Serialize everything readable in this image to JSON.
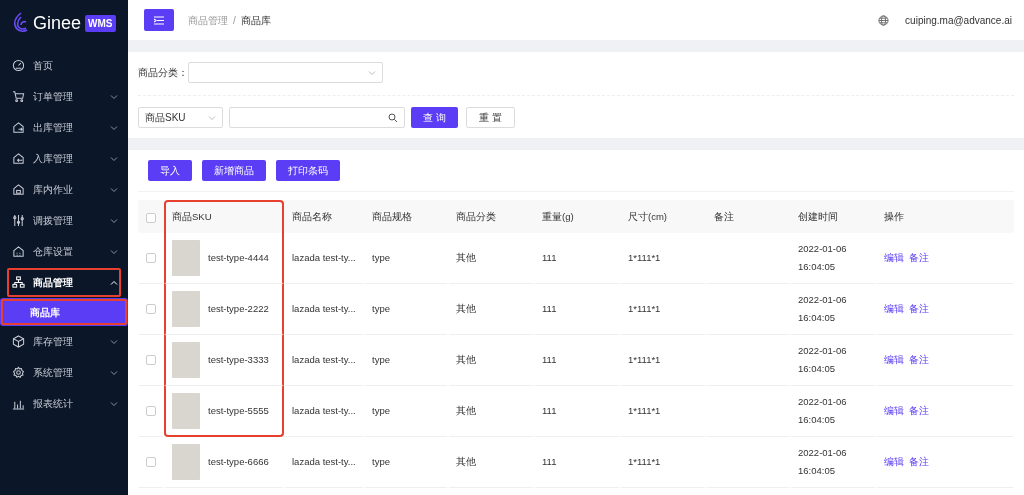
{
  "sidebar": {
    "logo": {
      "text": "Ginee",
      "badge": "WMS"
    },
    "items": [
      {
        "label": "首页",
        "selected": false,
        "highlighted": false
      },
      {
        "label": "订单管理",
        "expanded": false,
        "selected": false,
        "highlighted": false
      },
      {
        "label": "出库管理",
        "expanded": false,
        "selected": false,
        "highlighted": false
      },
      {
        "label": "入库管理",
        "expanded": false,
        "selected": false,
        "highlighted": false
      },
      {
        "label": "库内作业",
        "expanded": false,
        "selected": false,
        "highlighted": false
      },
      {
        "label": "调拨管理",
        "expanded": false,
        "selected": false,
        "highlighted": false
      },
      {
        "label": "仓库设置",
        "expanded": false,
        "selected": false,
        "highlighted": false
      },
      {
        "label": "商品管理",
        "expanded": true,
        "selected": true,
        "highlighted": true,
        "children": [
          {
            "label": "商品库",
            "selected": true,
            "highlighted": true
          }
        ]
      },
      {
        "label": "库存管理",
        "expanded": false,
        "selected": false,
        "highlighted": false
      },
      {
        "label": "系统管理",
        "expanded": false,
        "selected": false,
        "highlighted": false
      },
      {
        "label": "报表统计",
        "expanded": false,
        "selected": false,
        "highlighted": false
      }
    ]
  },
  "header": {
    "breadcrumb": [
      "商品管理",
      "/",
      "商品库"
    ],
    "user": "cuiping.ma@advance.ai"
  },
  "filters": {
    "category_label": "商品分类：",
    "search_type": "商品SKU",
    "buttons": [
      "查 询",
      "重 置"
    ]
  },
  "actions": [
    "导入",
    "新增商品",
    "打印条码"
  ],
  "table": {
    "all_checked": false,
    "columns": [
      {
        "label": "商品SKU",
        "highlighted": true
      },
      {
        "label": "商品名称",
        "highlighted": false
      },
      {
        "label": "商品规格",
        "highlighted": false
      },
      {
        "label": "商品分类",
        "highlighted": false
      },
      {
        "label": "重量(g)",
        "highlighted": false
      },
      {
        "label": "尺寸(cm)",
        "highlighted": false
      },
      {
        "label": "备注",
        "highlighted": false
      },
      {
        "label": "创建时间",
        "highlighted": false
      },
      {
        "label": "操作",
        "highlighted": false
      }
    ],
    "rows": [
      {
        "checked": false,
        "highlighted": true,
        "sku": "test-type-4444",
        "name": "lazada test-ty...",
        "spec": "type",
        "category": "其他",
        "weight": "111",
        "size": "1*111*1",
        "date": "2022-01-06",
        "time": "16:04:05",
        "actions": [
          "编辑",
          "备注"
        ]
      },
      {
        "checked": false,
        "highlighted": true,
        "sku": "test-type-2222",
        "name": "lazada test-ty...",
        "spec": "type",
        "category": "其他",
        "weight": "111",
        "size": "1*111*1",
        "date": "2022-01-06",
        "time": "16:04:05",
        "actions": [
          "编辑",
          "备注"
        ]
      },
      {
        "checked": false,
        "highlighted": true,
        "sku": "test-type-3333",
        "name": "lazada test-ty...",
        "spec": "type",
        "category": "其他",
        "weight": "111",
        "size": "1*111*1",
        "date": "2022-01-06",
        "time": "16:04:05",
        "actions": [
          "编辑",
          "备注"
        ]
      },
      {
        "checked": false,
        "highlighted": true,
        "sku": "test-type-5555",
        "name": "lazada test-ty...",
        "spec": "type",
        "category": "其他",
        "weight": "111",
        "size": "1*111*1",
        "date": "2022-01-06",
        "time": "16:04:05",
        "actions": [
          "编辑",
          "备注"
        ]
      },
      {
        "checked": false,
        "highlighted": false,
        "sku": "test-type-6666",
        "name": "lazada test-ty...",
        "spec": "type",
        "category": "其他",
        "weight": "111",
        "size": "1*111*1",
        "date": "2022-01-06",
        "time": "16:04:05",
        "actions": [
          "编辑",
          "备注"
        ]
      }
    ]
  }
}
